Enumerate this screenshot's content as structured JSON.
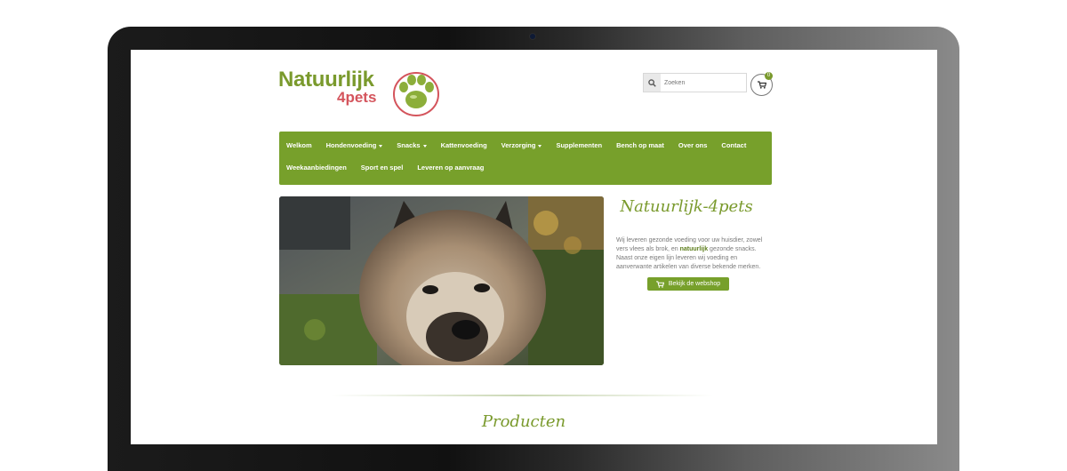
{
  "brand": {
    "name_line1": "Natuurlijk",
    "name_line2": "4pets",
    "green": "#7a9a2d",
    "red": "#d4545c"
  },
  "search": {
    "placeholder": "Zoeken",
    "icon": "search-icon"
  },
  "cart": {
    "count": "0",
    "icon": "cart-icon"
  },
  "nav": {
    "row1": [
      {
        "label": "Welkom",
        "dropdown": false
      },
      {
        "label": "Hondenvoeding",
        "dropdown": true
      },
      {
        "label": "Snacks",
        "dropdown": true
      },
      {
        "label": "Kattenvoeding",
        "dropdown": false
      },
      {
        "label": "Verzorging",
        "dropdown": true
      },
      {
        "label": "Supplementen",
        "dropdown": false
      },
      {
        "label": "Bench op maat",
        "dropdown": false
      },
      {
        "label": "Over ons",
        "dropdown": false
      },
      {
        "label": "Contact",
        "dropdown": false
      }
    ],
    "row2": [
      {
        "label": "Weekaanbiedingen",
        "dropdown": false
      },
      {
        "label": "Sport en spel",
        "dropdown": false
      },
      {
        "label": "Leveren op aanvraag",
        "dropdown": false
      }
    ],
    "color": "#77a02b"
  },
  "intro": {
    "title": "Natuurlijk-4pets",
    "text_before": "Wij leveren gezonde voeding voor uw huisdier, zowel vers vlees als brok, en ",
    "text_bold": "natuurlijk",
    "text_after": " gezonde snacks. Naast onze eigen lijn leveren wij voeding en aanverwante artikelen van diverse bekende merken.",
    "button_label": "Bekijk de webshop"
  },
  "products": {
    "title": "Producten"
  }
}
